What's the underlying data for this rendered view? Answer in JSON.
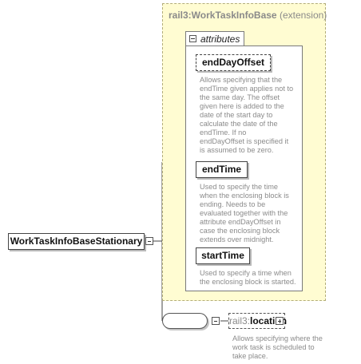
{
  "extension": {
    "name": "rail3:WorkTaskInfoBase",
    "kind": " (extension)"
  },
  "attributes_group": {
    "label": "attributes",
    "items": [
      {
        "name": "endDayOffset",
        "optional": true,
        "description": "Allows specifying that the\nendTime given applies not to\nthe same day. The offset\ngiven here is added to the\ndate of the start day to\ncalculate the date of the\nendTime. If no\nendDayOffset is specified it\nis assumed to be zero."
      },
      {
        "name": "endTime",
        "optional": false,
        "description": "Used to specify the time\nwhen the enclosing block is\nending. Needs to be\nevaluated together with the\nattribute endDayOffset in\ncase the enclosing block\nextends over midnight."
      },
      {
        "name": "startTime",
        "optional": false,
        "description": "Used to specify a time when\nthe enclosing block is started."
      }
    ]
  },
  "root_element": {
    "name": "WorkTaskInfoBaseStationary"
  },
  "child_element": {
    "namespace": "rail3:",
    "name": "location",
    "description": "Allows specifying where the\nwork task is scheduled to\ntake place."
  }
}
